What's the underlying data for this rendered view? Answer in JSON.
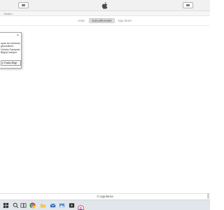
{
  "window": {
    "menu_label": "Yardım"
  },
  "tabs": [
    {
      "label": "Arşiv",
      "active": false
    },
    {
      "label": "Güncellemeler",
      "active": true
    },
    {
      "label": "App Store",
      "active": false
    }
  ],
  "popup": {
    "lines": [
      "",
      "uyan bir sürümünü",
      "güncelleme",
      "Ürünün Tavsiyesi ",
      "Bilgi’yi indiryor"
    ],
    "button_label": "n Fazla Bilgi"
  },
  "status": {
    "text": "3 uygulama"
  },
  "taskbar": {
    "icons": [
      "start-icon",
      "search-icon",
      "task-view-icon",
      "chrome-icon",
      "file-explorer-icon",
      "mail-icon",
      "photos-icon",
      "media-icon",
      "itunes-icon"
    ]
  },
  "colors": {
    "taskbar": "#e1e6ec",
    "toolbar": "#f1f1f1",
    "accent": "#3a78c8"
  }
}
